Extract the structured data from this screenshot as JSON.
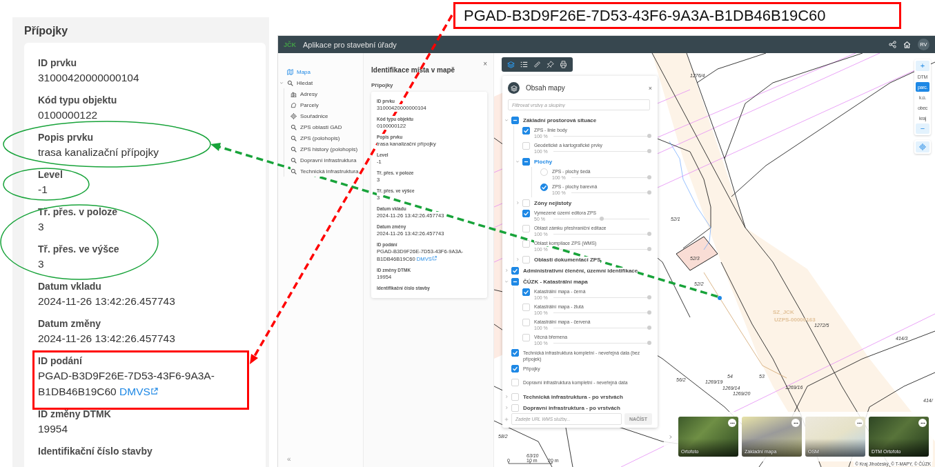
{
  "zoomed_panel": {
    "title": "Přípojky",
    "fields": [
      {
        "label": "ID prvku",
        "value": "31000420000000104"
      },
      {
        "label": "Kód typu objektu",
        "value": "0100000122"
      },
      {
        "label": "Popis prvku",
        "value": "trasa kanalizační přípojky"
      },
      {
        "label": "Level",
        "value": "-1"
      },
      {
        "label": "Tř. přes. v poloze",
        "value": "3"
      },
      {
        "label": "Tř. přes. ve výšce",
        "value": "3"
      },
      {
        "label": "Datum vkladu",
        "value": "2024-11-26 13:42:26.457743"
      },
      {
        "label": "Datum změny",
        "value": "2024-11-26 13:42:26.457743"
      },
      {
        "label": "ID podání",
        "value": "PGAD-B3D9F26E-7D53-43F6-9A3A-B1DB46B19C60",
        "link": "DMVS"
      },
      {
        "label": "ID změny DTMK",
        "value": "19954"
      },
      {
        "label": "Identifikační číslo stavby"
      }
    ]
  },
  "callout": {
    "text": "PGAD-B3D9F26E-7D53-43F6-9A3A-B1DB46B19C60"
  },
  "app": {
    "logo": "JČK",
    "title": "Aplikace pro stavební úřady",
    "user_initials": "RV"
  },
  "sidebar": {
    "items": [
      {
        "label": "Mapa",
        "selected": true
      },
      {
        "label": "Hledat",
        "selected": false,
        "expanded": true,
        "children": [
          {
            "label": "Adresy",
            "selected": false
          },
          {
            "label": "Parcely",
            "selected": false
          },
          {
            "label": "Souřadnice",
            "selected": false
          },
          {
            "label": "ZPS oblasti GAD",
            "selected": false
          },
          {
            "label": "ZPS (polohopis)",
            "selected": false
          },
          {
            "label": "ZPS history (polohopis)",
            "selected": false
          },
          {
            "label": "Dopravní infrastruktura",
            "selected": false
          },
          {
            "label": "Technická infrastruktura",
            "selected": false
          }
        ]
      }
    ],
    "collapse": "«"
  },
  "identify_panel": {
    "title": "Identifikace místa v mapě",
    "close": "×",
    "section": "Přípojky",
    "fields": [
      {
        "label": "ID prvku",
        "value": "31000420000000104"
      },
      {
        "label": "Kód typu objektu",
        "value": "0100000122"
      },
      {
        "label": "Popis prvku",
        "value": "trasa kanalizační přípojky"
      },
      {
        "label": "Level",
        "value": "-1"
      },
      {
        "label": "Tř. přes. v poloze",
        "value": "3"
      },
      {
        "label": "Tř. přes. ve výšce",
        "value": "3"
      },
      {
        "label": "Datum vkladu",
        "value": "2024-11-26 13:42:26.457743"
      },
      {
        "label": "Datum změny",
        "value": "2024-11-26 13:42:26.457743"
      },
      {
        "label": "ID podání",
        "value": "PGAD-B3D9F26E-7D53-43F6-9A3A-B1DB46B19C60",
        "link": "DMVS"
      },
      {
        "label": "ID změny DTMK",
        "value": "19954"
      },
      {
        "label": "Identifikační číslo stavby"
      }
    ]
  },
  "map_toolbar": {
    "tools": [
      {
        "selected": true
      },
      {
        "selected": false
      },
      {
        "selected": false
      },
      {
        "selected": false
      },
      {
        "selected": false
      }
    ]
  },
  "map_layers": {
    "title": "Obsah mapy",
    "close": "×",
    "filter_placeholder": "Filtrovat vrstvy a skupiny",
    "items": [
      {
        "kind": "group",
        "label": "Základní prostorová situace",
        "expanded": true,
        "checked": false,
        "indeterminate": true,
        "highlighted": false,
        "children": [
          {
            "kind": "layer",
            "label": "ZPS - linie body",
            "checked": true,
            "opacity": "100 %",
            "level": 1
          },
          {
            "kind": "layer",
            "label": "Geodetické a kartografické prvky",
            "checked": false,
            "opacity": "100 %",
            "level": 1
          },
          {
            "kind": "group",
            "label": "Plochy",
            "expanded": true,
            "checked": false,
            "indeterminate": true,
            "highlighted": true,
            "children": [
              {
                "kind": "radio",
                "label": "ZPS - plochy šedá",
                "selected": false,
                "opacity": "100 %",
                "level": 1
              },
              {
                "kind": "radio",
                "label": "ZPS - plochy barevná",
                "selected": true,
                "opacity": "100 %",
                "level": 1
              }
            ]
          },
          {
            "kind": "group",
            "label": "Zóny nejistoty",
            "expanded": false,
            "checked": false,
            "indeterminate": false,
            "highlighted": false
          },
          {
            "kind": "layer",
            "label": "Vymezené území editora ZPS",
            "checked": true,
            "opacity": "50 %",
            "level": 0.5
          },
          {
            "kind": "layer",
            "label": "Oblast zámku přeshraniční editace",
            "checked": false,
            "opacity": "100 %",
            "level": 1
          },
          {
            "kind": "layer",
            "label": "Oblast kompilace ZPS (WMS)",
            "checked": false,
            "opacity": "100 %",
            "level": 1
          },
          {
            "kind": "group",
            "label": "Oblasti dokumentací ZPS",
            "expanded": false,
            "checked": false,
            "indeterminate": false,
            "highlighted": false
          }
        ]
      },
      {
        "kind": "group",
        "label": "Administrativní členění, územní identifikace",
        "expanded": false,
        "checked": true,
        "indeterminate": false,
        "highlighted": false
      },
      {
        "kind": "group",
        "label": "ČÚZK - Katastrální mapa",
        "expanded": true,
        "checked": false,
        "indeterminate": true,
        "highlighted": false,
        "children": [
          {
            "kind": "layer",
            "label": "Katastrální mapa - černá",
            "checked": true,
            "opacity": "100 %",
            "level": 1
          },
          {
            "kind": "layer",
            "label": "Katastrální mapa - žlutá",
            "checked": false,
            "opacity": "100 %",
            "level": 1
          },
          {
            "kind": "layer",
            "label": "Katastrální mapa - červená",
            "checked": false,
            "opacity": "100 %",
            "level": 1
          },
          {
            "kind": "layer",
            "label": "Věcná břemena",
            "checked": false,
            "opacity": "100 %",
            "level": 1
          }
        ]
      },
      {
        "kind": "plain",
        "label": "Technická infrastruktura kompletní - neveřejná data (bez přípojek)",
        "checked": true
      },
      {
        "kind": "plain",
        "label": "Přípojky",
        "checked": true
      },
      {
        "kind": "plain",
        "label": "Dopravní infrastruktura kompletní - neveřejná data",
        "checked": false
      },
      {
        "kind": "group",
        "label": "Technická infrastruktura - po vrstvách",
        "expanded": false,
        "checked": false,
        "indeterminate": false,
        "highlighted": false
      },
      {
        "kind": "group",
        "label": "Dopravní infrastruktura - po vrstvách",
        "expanded": false,
        "checked": false,
        "indeterminate": false,
        "highlighted": false
      }
    ],
    "wms_placeholder": "Zadejte URL WMS služby...",
    "load_button": {
      "label": "NAČÍST",
      "disabled": true
    }
  },
  "map_controls": {
    "zoom_in": "+",
    "zoom_out": "−",
    "scale_levels": [
      {
        "label": "DTM",
        "selected": false
      },
      {
        "label": "parc.",
        "selected": true
      },
      {
        "label": "k.ú.",
        "selected": false
      },
      {
        "label": "obec",
        "selected": false
      },
      {
        "label": "kraj",
        "selected": false
      }
    ]
  },
  "basemaps": [
    {
      "label": "Ortofoto"
    },
    {
      "label": "Základní mapa"
    },
    {
      "label": "OSM"
    },
    {
      "label": "DTM Ortofoto"
    }
  ],
  "map": {
    "labels": [
      "1276/4",
      "52/1",
      "52/3",
      "52/2",
      "1272/5",
      "414/3",
      "54",
      "53",
      "56/2",
      "1269/19",
      "1269/14",
      "1269/20",
      "1269/16",
      "414/",
      "58/2",
      "63/10"
    ],
    "zone_labels": [
      "SZ_JCK",
      "UZPS-00000163"
    ],
    "scale": [
      "0",
      "10 m",
      "20 m"
    ],
    "attribution": "© Kraj Jihočeský, © T-MAPY, © ČÚZK"
  }
}
